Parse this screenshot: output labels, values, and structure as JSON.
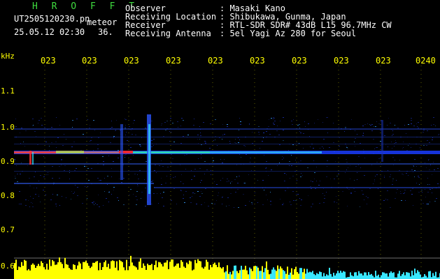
{
  "header": {
    "app_name": "H R O F F T",
    "filename": "UT2505120230.pn",
    "meteor_label": "meteor",
    "datetime": "25.05.12 02:30",
    "count": "36.",
    "meta": [
      {
        "key": "Observer",
        "value": ": Masaki Kano"
      },
      {
        "key": "Receiving Location",
        "value": ": Shibukawa, Gunma, Japan"
      },
      {
        "key": "Receiver",
        "value": ": RTL-SDR SDR# 43dB L15 96.7MHz CW"
      },
      {
        "key": "Receiving Antenna",
        "value": ": 5el Yagi Az 280 for Seoul"
      }
    ]
  },
  "axis": {
    "y_unit": "kHz",
    "y_ticks": [
      "1.1",
      "1.0",
      "0.9",
      "0.8",
      "0.7",
      "0.6"
    ],
    "x_ticks": [
      "023",
      "023",
      "023",
      "023",
      "023",
      "023",
      "023",
      "023",
      "023",
      "0240"
    ]
  },
  "colors": {
    "text": "#ffffff",
    "accent_yellow": "#ffff00",
    "title_green": "#3fdc3f",
    "signal_blue": "#2a56ff",
    "signal_red": "#ff3030",
    "signal_cyan": "#38e6ff"
  }
}
